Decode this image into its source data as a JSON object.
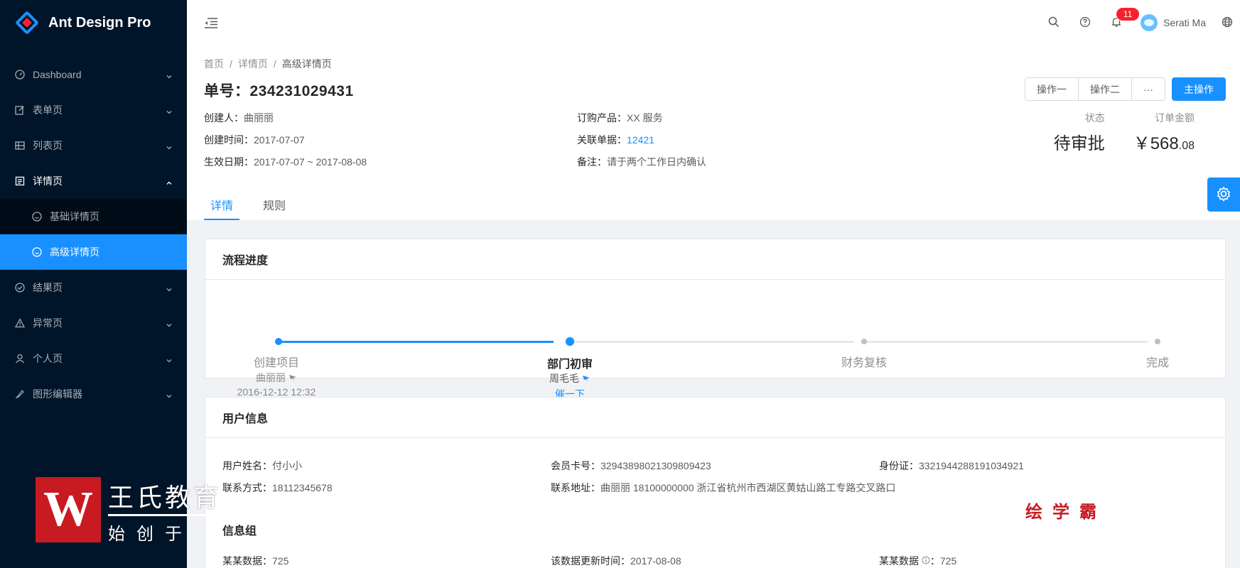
{
  "app": {
    "title": "Ant Design Pro"
  },
  "sidebar": {
    "items": [
      {
        "label": "Dashboard",
        "icon": "dashboard-icon"
      },
      {
        "label": "表单页",
        "icon": "form-icon"
      },
      {
        "label": "列表页",
        "icon": "table-icon"
      },
      {
        "label": "详情页",
        "icon": "profile-icon",
        "open": true,
        "children": [
          {
            "label": "基础详情页",
            "icon": "smile-icon"
          },
          {
            "label": "高级详情页",
            "icon": "smile-icon",
            "active": true
          }
        ]
      },
      {
        "label": "结果页",
        "icon": "check-circle-icon"
      },
      {
        "label": "异常页",
        "icon": "warning-icon"
      },
      {
        "label": "个人页",
        "icon": "user-icon"
      },
      {
        "label": "图形编辑器",
        "icon": "highlight-icon"
      }
    ]
  },
  "header": {
    "notification_count": "11",
    "user_name": "Serati Ma"
  },
  "breadcrumb": [
    "首页",
    "详情页",
    "高级详情页"
  ],
  "page": {
    "title": "单号：234231029431",
    "actions": {
      "op1": "操作一",
      "op2": "操作二",
      "more": "···",
      "primary": "主操作"
    },
    "description": {
      "creator_label": "创建人：",
      "creator": "曲丽丽",
      "product_label": "订购产品：",
      "product": "XX 服务",
      "created_label": "创建时间：",
      "created": "2017-07-07",
      "ref_label": "关联单据：",
      "ref": "12421",
      "effective_label": "生效日期：",
      "effective": "2017-07-07 ~ 2017-08-08",
      "note_label": "备注：",
      "note": "请于两个工作日内确认"
    },
    "extra": {
      "status_label": "状态",
      "status": "待审批",
      "amount_label": "订单金额",
      "amount_int": "￥568",
      "amount_dec": ".08"
    },
    "tabs": [
      "详情",
      "规则"
    ]
  },
  "progress": {
    "title": "流程进度",
    "steps": [
      {
        "title": "创建项目",
        "person": "曲丽丽",
        "time": "2016-12-12 12:32",
        "state": "done"
      },
      {
        "title": "部门初审",
        "person": "周毛毛",
        "action": "催一下",
        "state": "current"
      },
      {
        "title": "财务复核",
        "state": "wait"
      },
      {
        "title": "完成",
        "state": "wait"
      }
    ]
  },
  "user_info": {
    "title": "用户信息",
    "name_label": "用户姓名：",
    "name": "付小小",
    "card_label": "会员卡号：",
    "card": "32943898021309809423",
    "id_label": "身份证：",
    "id": "3321944288191034921",
    "phone_label": "联系方式：",
    "phone": "18112345678",
    "address_label": "联系地址：",
    "address": "曲丽丽 18100000000 浙江省杭州市西湖区黄姑山路工专路交叉路口",
    "group_title": "信息组",
    "data1_label": "某某数据：",
    "data1": "725",
    "data2_label": "该数据更新时间：",
    "data2": "2017-08-08",
    "data3_label": "某某数据",
    "data3": "725"
  },
  "watermark": {
    "logo_letter": "W",
    "title": "王氏教育",
    "subtitle": "始创于",
    "right_text": "绘学霸"
  },
  "colors": {
    "primary": "#1890ff",
    "sider": "#001529",
    "badge": "#f5222d"
  }
}
